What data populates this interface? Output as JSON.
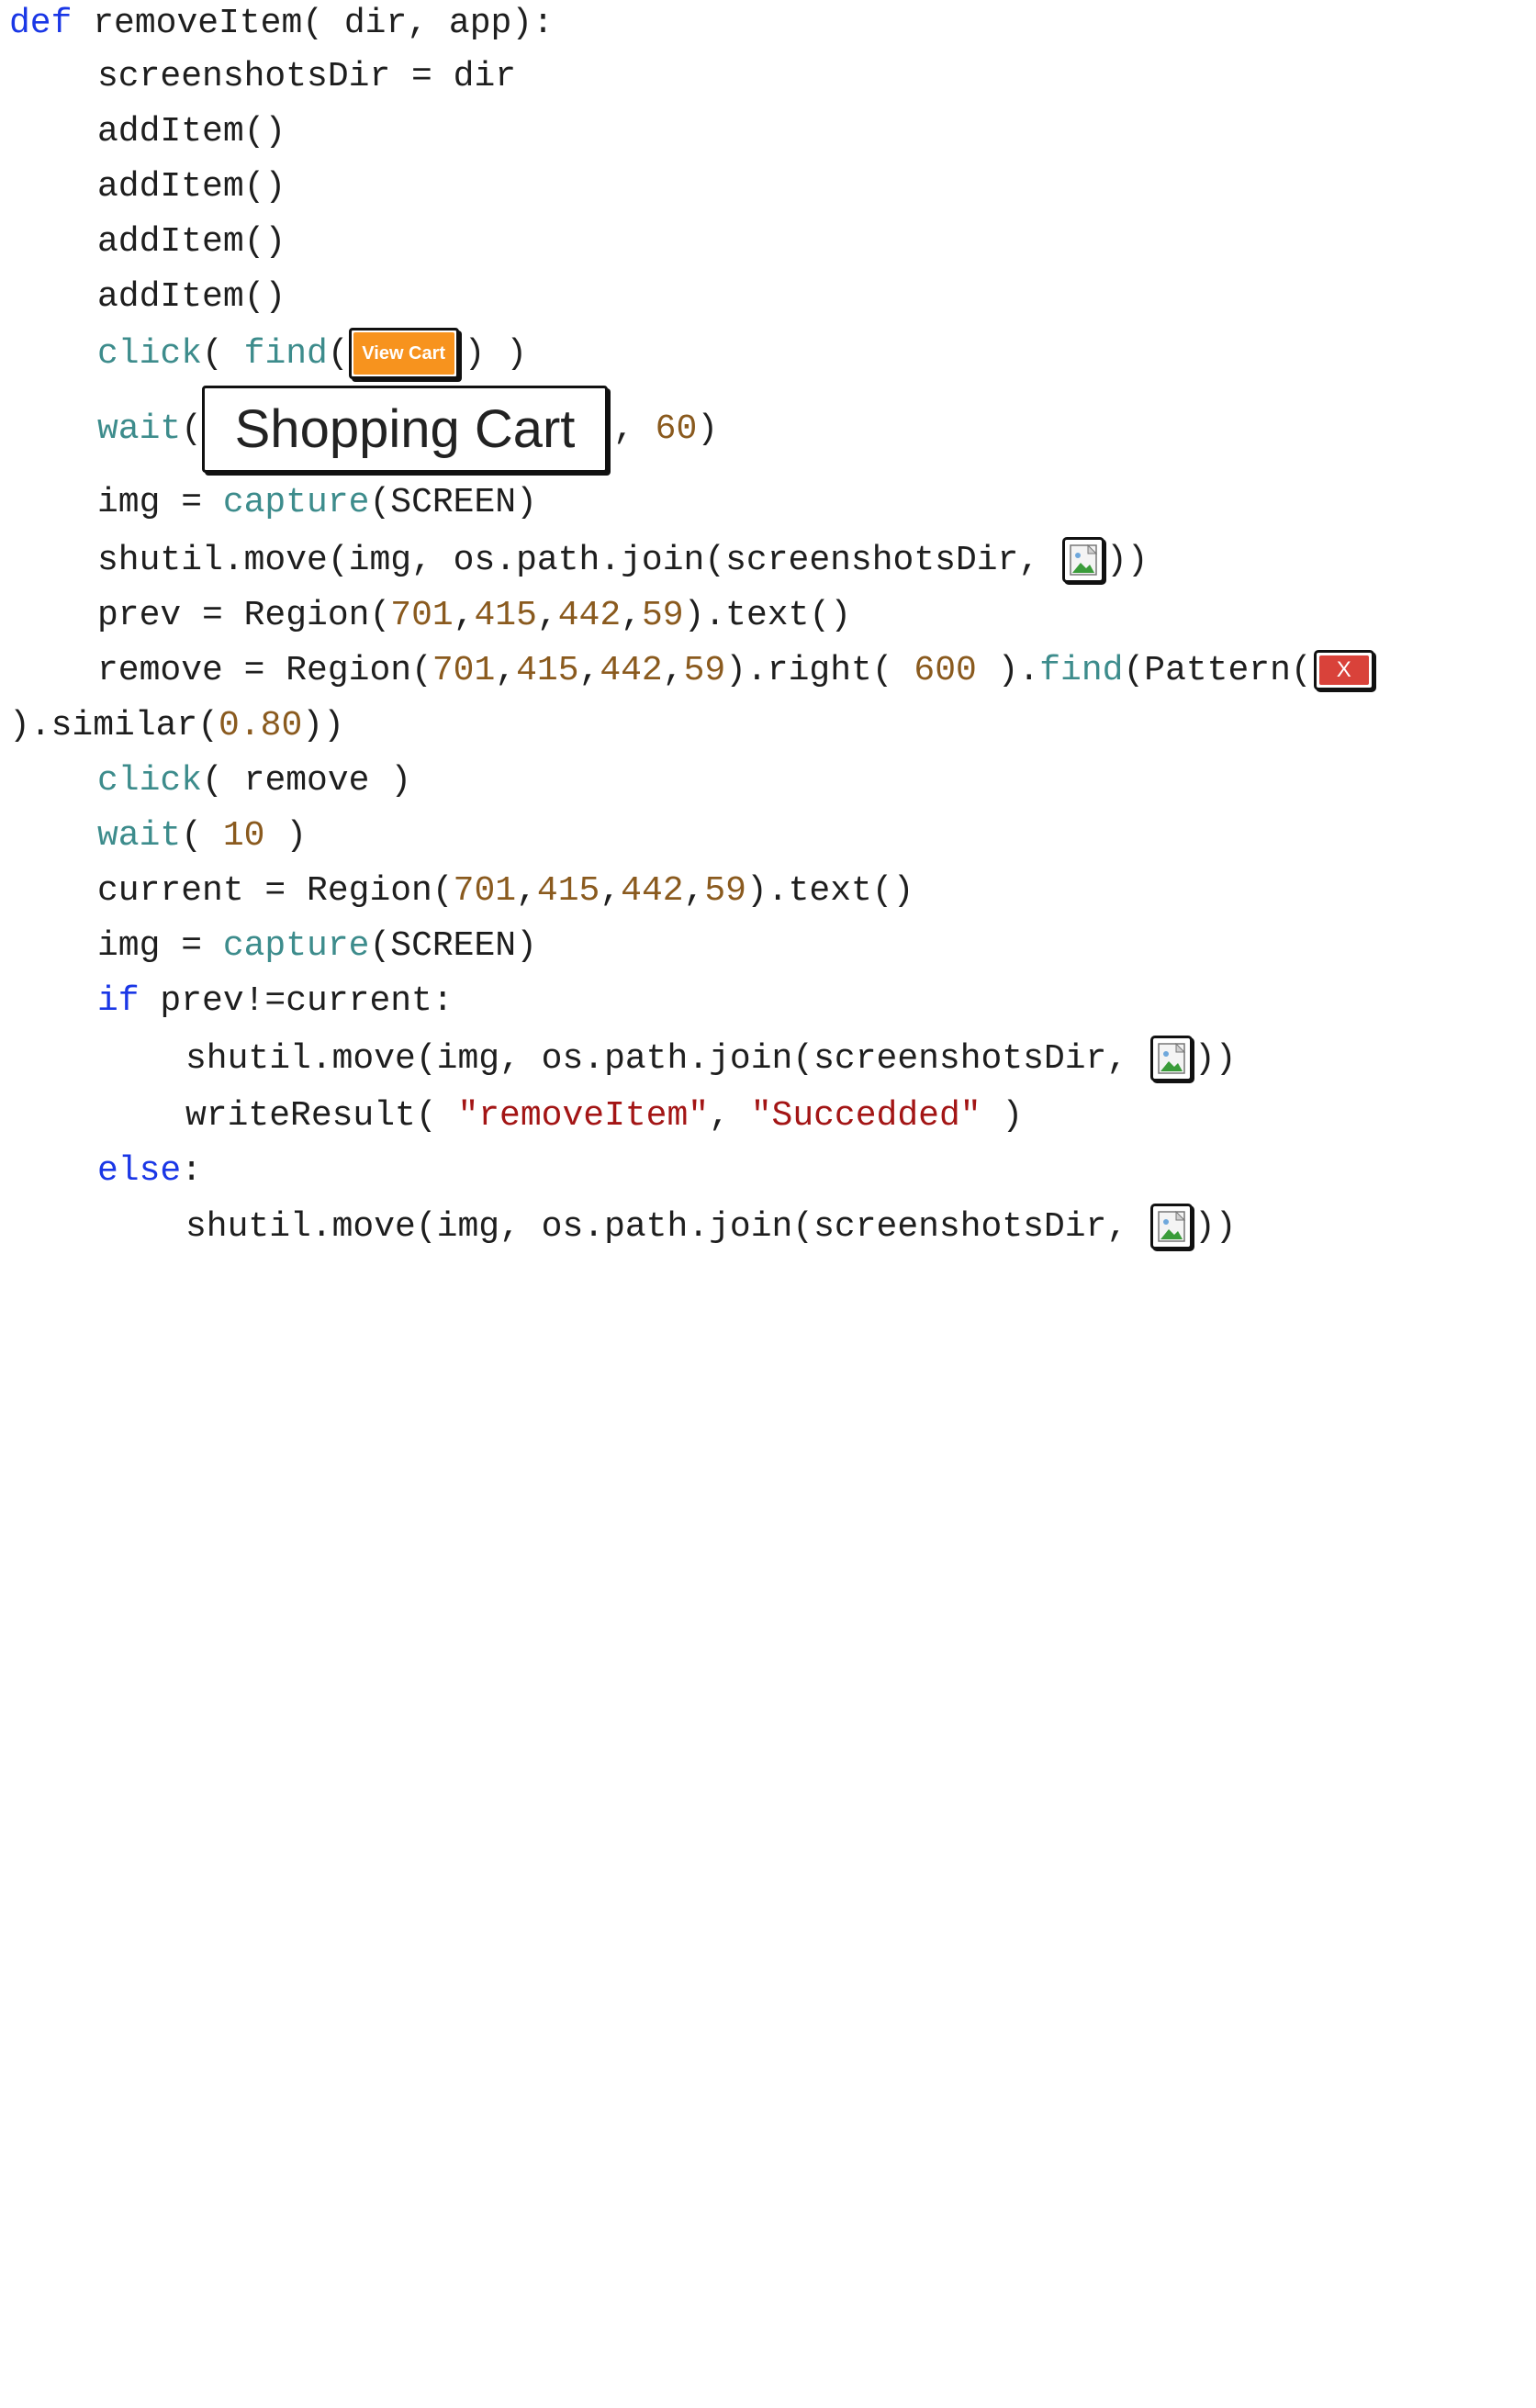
{
  "code": {
    "l1_kw": "def",
    "l1_rest": " removeItem( dir, app):",
    "l2": "screenshotsDir = dir",
    "l3": "addItem()",
    "l4": "addItem()",
    "l5": "addItem()",
    "l6": "addItem()",
    "l7_click": "click",
    "l7_paren": "( ",
    "l7_find": "find",
    "l7_open": "(",
    "l7_close": ") )",
    "l8_wait": "wait",
    "l8_open": "(",
    "l8_comma": ", ",
    "l8_num": "60",
    "l8_close": ")",
    "l9_a": "img = ",
    "l9_fn": "capture",
    "l9_b": "(SCREEN)",
    "l10_a": "shutil.move(img, os.path.join(screenshotsDir, ",
    "l10_b": "))",
    "l11_a": "prev = Region(",
    "l11_n1": "701",
    "l11_n2": "415",
    "l11_n3": "442",
    "l11_n4": "59",
    "l11_b": ").text()",
    "l12_a": "remove = Region(",
    "l12_n1": "701",
    "l12_n2": "415",
    "l12_n3": "442",
    "l12_n4": "59",
    "l12_b": ").right( ",
    "l12_n5": "600",
    "l12_c": " ).",
    "l12_fn": "find",
    "l12_d": "(Pattern(",
    "l13_a": ").similar(",
    "l13_n": "0.80",
    "l13_b": "))",
    "l14_fn": "click",
    "l14_b": "( remove )",
    "l15_fn": "wait",
    "l15_a": "( ",
    "l15_n": "10",
    "l15_b": " )",
    "l16_a": "current = Region(",
    "l16_n1": "701",
    "l16_n2": "415",
    "l16_n3": "442",
    "l16_n4": "59",
    "l16_b": ").text()",
    "l17_a": "img = ",
    "l17_fn": "capture",
    "l17_b": "(SCREEN)",
    "l18_kw": "if",
    "l18_b": " prev!=current:",
    "l19_a": "shutil.move(img, os.path.join(screenshotsDir, ",
    "l19_b": "))",
    "l20_a": "writeResult( ",
    "l20_s1": "\"removeItem\"",
    "l20_b": ", ",
    "l20_s2": "\"Succedded\"",
    "l20_c": " )",
    "l21_kw": "else",
    "l21_b": ":",
    "l22_a": "shutil.move(img, os.path.join(screenshotsDir, ",
    "l22_b": "))",
    "comma": ","
  },
  "images": {
    "view_cart_label": "View Cart",
    "shopping_cart_label": "Shopping Cart",
    "x_label": "X",
    "picture_icon": "picture-icon"
  },
  "colors": {
    "keyword": "#1a37e6",
    "function": "#3d8c8c",
    "number": "#8a5a1e",
    "string": "#a31515",
    "view_cart_bg": "#f7931e",
    "x_bg": "#d9423a"
  }
}
